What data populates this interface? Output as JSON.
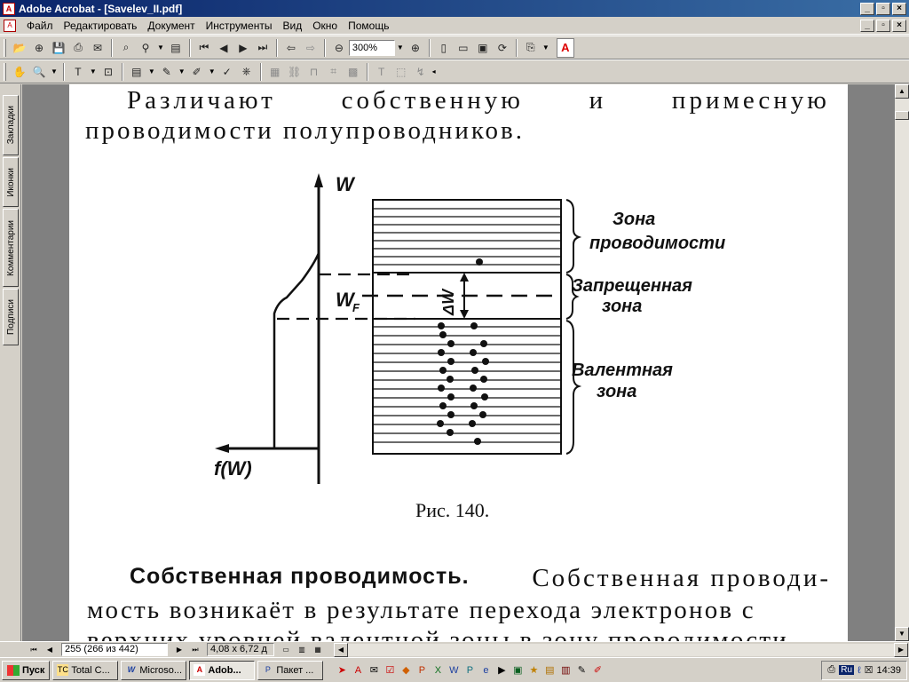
{
  "window": {
    "title": "Adobe Acrobat - [Savelev_II.pdf]"
  },
  "menu": {
    "items": [
      "Файл",
      "Редактировать",
      "Документ",
      "Инструменты",
      "Вид",
      "Окно",
      "Помощь"
    ]
  },
  "toolbar": {
    "zoom_value": "300%"
  },
  "navtabs": [
    "Закладки",
    "Иконки",
    "Комментарии",
    "Подписи"
  ],
  "document": {
    "para1_line1": [
      "Различают",
      "собственную",
      "и",
      "примесную"
    ],
    "para1_line2": "проводимости полупроводников.",
    "figure": {
      "w_axis": "W",
      "f_axis": "f(W)",
      "fermi": "W",
      "fermi_sub": "F",
      "delta": "ΔW",
      "conduction_1": "Зона",
      "conduction_2": "проводимости",
      "forbidden_1": "Запрещенная",
      "forbidden_2": "зона",
      "valence_1": "Валентная",
      "valence_2": "зона"
    },
    "caption": "Рис. 140.",
    "para2_bold": "Собственная проводимость.",
    "para2_line1_rest": "Собственная проводи-",
    "para2_line2": "мость возникаёт в результате перехода электронов с",
    "para2_line3": "верхних уровней валентной зоны в зону проводимости"
  },
  "statusbar": {
    "page": "255 (266 из 442)",
    "size": "4,08 x 6,72 д"
  },
  "taskbar": {
    "start": "Пуск",
    "tasks": [
      {
        "label": "Total C...",
        "icon": "TC",
        "active": false
      },
      {
        "label": "Microso...",
        "icon": "W",
        "active": false
      },
      {
        "label": "Adob...",
        "icon": "A",
        "active": true
      },
      {
        "label": "Пакет ...",
        "icon": "P",
        "active": false
      }
    ],
    "lang": "Ru",
    "time": "14:39"
  }
}
